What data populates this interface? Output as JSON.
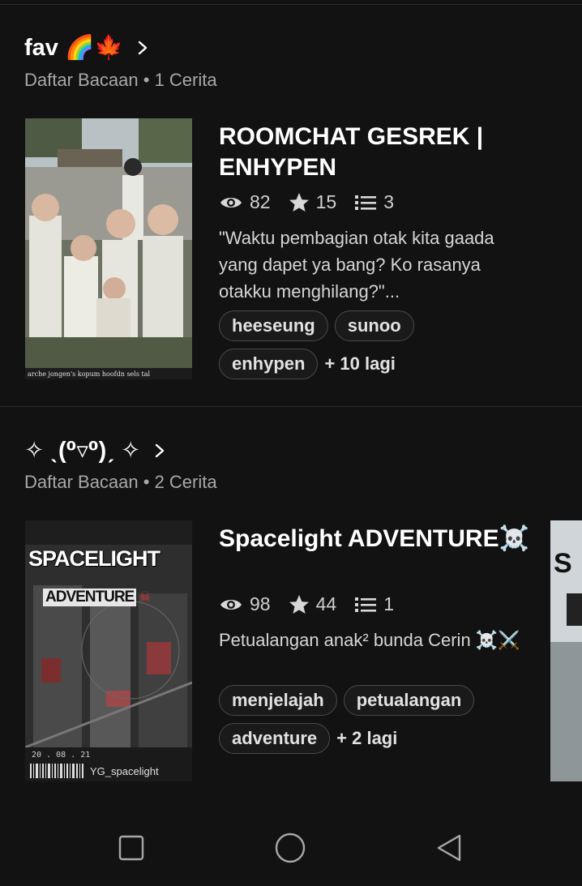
{
  "lists": [
    {
      "title": "fav 🌈🍁",
      "subtitle": "Daftar Bacaan • 1 Cerita",
      "story": {
        "title": "ROOMCHAT GESREK | ENHYPEN",
        "reads": "82",
        "votes": "15",
        "parts": "3",
        "description": "\"Waktu pembagian otak kita gaada yang dapet ya bang? Ko rasanya otakku menghilang?\"...",
        "tags": [
          "heeseung",
          "sunoo",
          "enhypen"
        ],
        "more_tags": "+ 10 lagi",
        "cover_caption": "arche jongen's        kopum  hoofdn  sels   tal"
      }
    },
    {
      "title": "✧ ˎ(⁰▿⁰)ˏ ✧",
      "subtitle": "Daftar Bacaan • 2 Cerita",
      "story": {
        "title": "Spacelight ADVENTURE☠️",
        "reads": "98",
        "votes": "44",
        "parts": "1",
        "description": "Petualangan anak² bunda Cerin ☠️⚔️",
        "tags": [
          "menjelajah",
          "petualangan",
          "adventure"
        ],
        "more_tags": "+ 2 lagi",
        "cover_title": "SPACELIGHT",
        "cover_subtitle": "ADVENTURE",
        "cover_date": "20 . 08 . 21",
        "cover_author": "YG_spacelight",
        "peek_cover_text": "S"
      }
    }
  ],
  "navbar": {
    "icons": [
      "square-recent-apps-icon",
      "circle-home-icon",
      "triangle-back-icon"
    ]
  },
  "colors": {
    "background": "#121212",
    "text": "#ffffff",
    "muted": "#a8a8a8",
    "tag_border": "#4a4a4a"
  }
}
